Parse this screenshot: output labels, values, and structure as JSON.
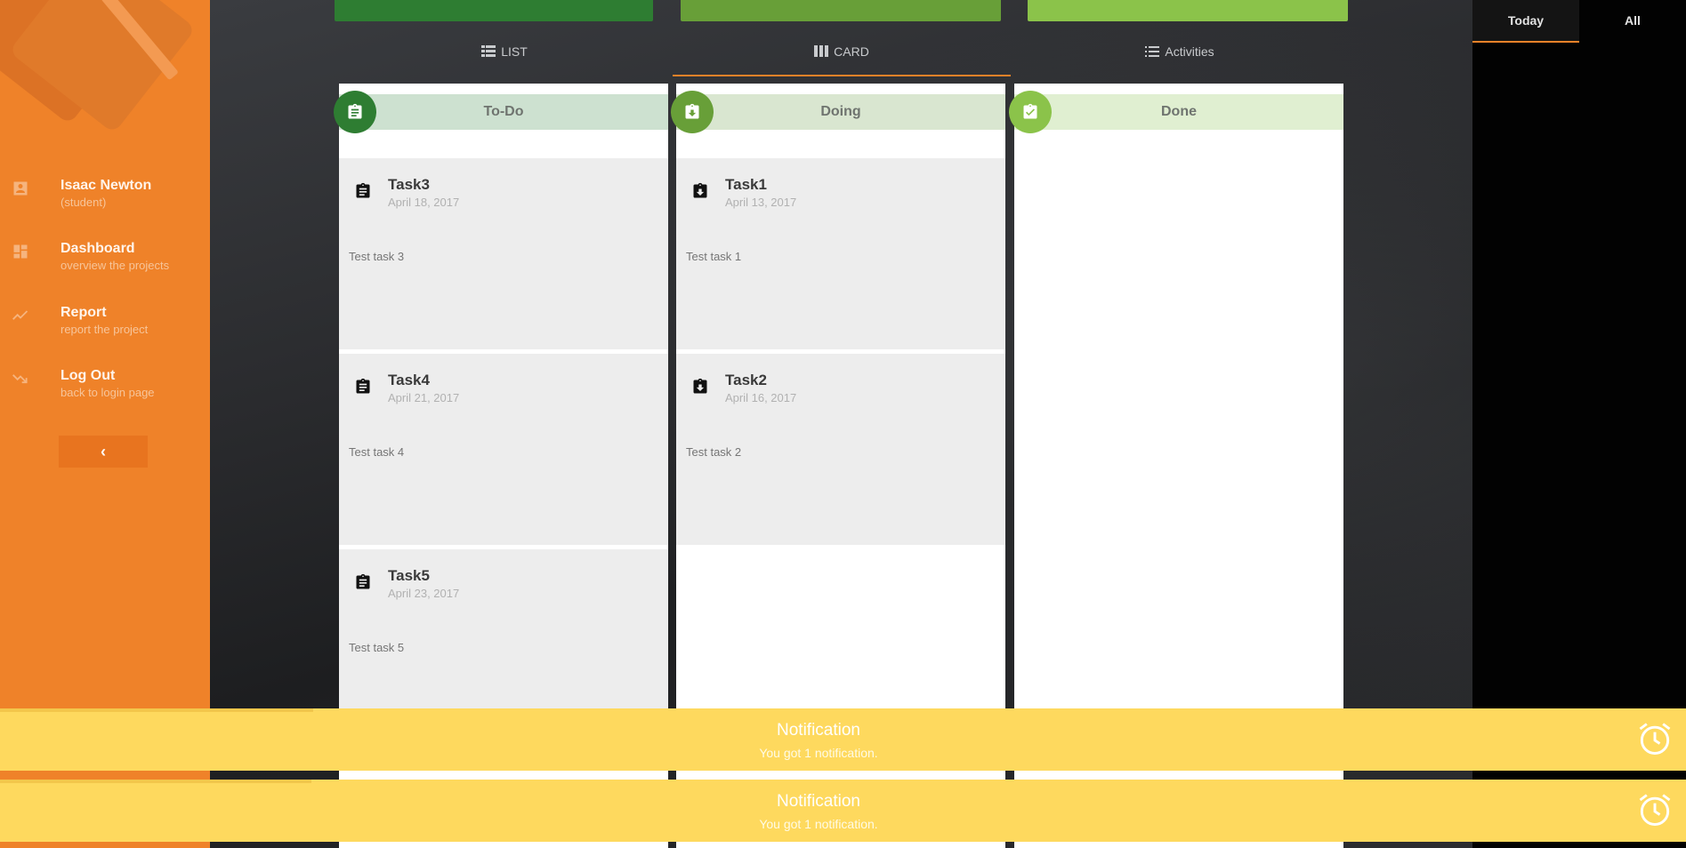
{
  "sidebar": {
    "profile": {
      "name": "Isaac Newton",
      "role": "(student)"
    },
    "nav": [
      {
        "title": "Dashboard",
        "subtitle": "overview the projects"
      },
      {
        "title": "Report",
        "subtitle": "report the project"
      },
      {
        "title": "Log Out",
        "subtitle": "back to login page"
      }
    ],
    "collapse_label": "‹"
  },
  "top_bars": {
    "colors": [
      "#2e8338",
      "#6aa23c",
      "#8bc34a"
    ]
  },
  "view_tabs": [
    {
      "label": "LIST",
      "icon": "list-view-icon",
      "active": false
    },
    {
      "label": "CARD",
      "icon": "card-view-icon",
      "active": true
    },
    {
      "label": "Activities",
      "icon": "activities-icon",
      "active": false
    }
  ],
  "columns": [
    {
      "title": "To-Do",
      "icon": "clipboard-text-icon",
      "badge_color": "#2e7d32",
      "header_color": "#cde1d0",
      "cards": [
        {
          "title": "Task3",
          "date": "April 18, 2017",
          "description": "Test task 3"
        },
        {
          "title": "Task4",
          "date": "April 21, 2017",
          "description": "Test task 4"
        },
        {
          "title": "Task5",
          "date": "April 23, 2017",
          "description": "Test task 5"
        }
      ]
    },
    {
      "title": "Doing",
      "icon": "clipboard-arrow-down-icon",
      "badge_color": "#689f38",
      "header_color": "#d9e6d0",
      "cards": [
        {
          "title": "Task1",
          "date": "April 13, 2017",
          "description": "Test task 1"
        },
        {
          "title": "Task2",
          "date": "April 16, 2017",
          "description": "Test task 2"
        }
      ]
    },
    {
      "title": "Done",
      "icon": "clipboard-check-icon",
      "badge_color": "#8bc34a",
      "header_color": "#e0efd1",
      "cards": []
    }
  ],
  "right_tabs": [
    {
      "label": "Today",
      "active": true
    },
    {
      "label": "All",
      "active": false
    }
  ],
  "notifications": [
    {
      "title": "Notification",
      "message": "You got 1 notification."
    },
    {
      "title": "Notification",
      "message": "You got 1 notification."
    }
  ],
  "colors": {
    "accent": "#ef8229",
    "notification": "#fed95e",
    "card_bg": "#ededed"
  }
}
